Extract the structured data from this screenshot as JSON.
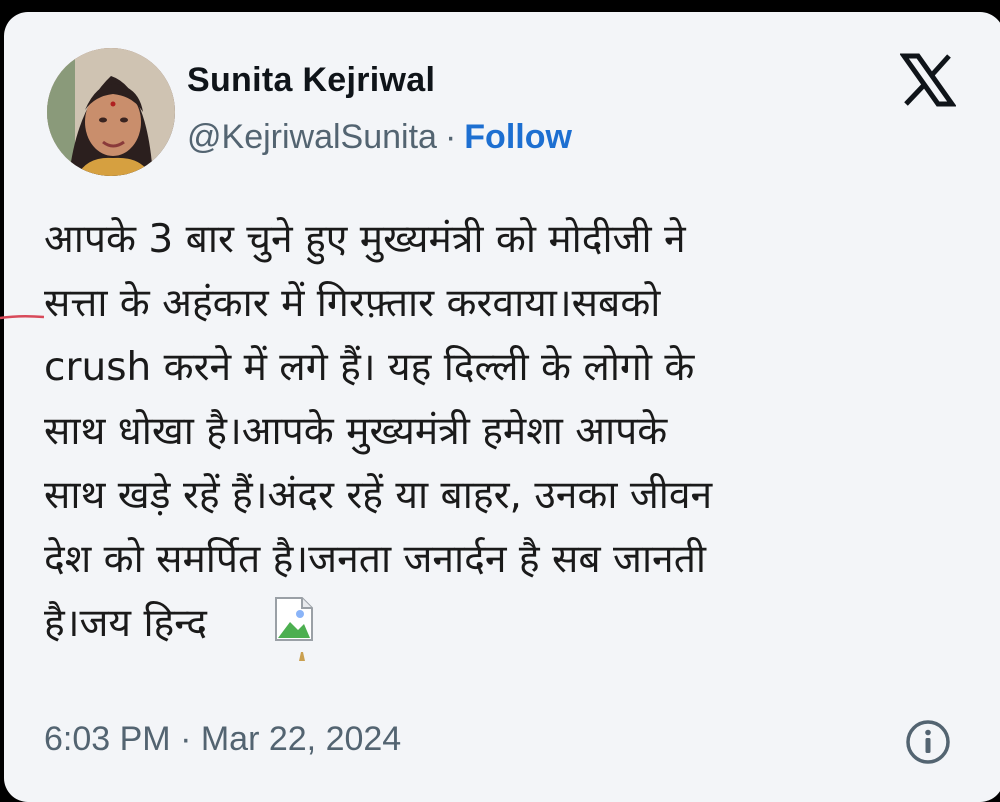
{
  "author": {
    "name": "Sunita Kejriwal",
    "handle": "@KejriwalSunita",
    "separator": "·",
    "follow_label": "Follow"
  },
  "tweet": {
    "text": "आपके 3 बार चुने हुए मुख्यमंत्री को मोदीजी ने\nसत्ता के अहंकार में गिरफ़्तार करवाया।सबको\ncrush करने में लगे हैं। यह दिल्ली के लोगो के\nसाथ धोखा है।आपके मुख्यमंत्री हमेशा आपके\nसाथ खड़े रहें हैं।अंदर रहें या बाहर, उनका जीवन\nदेश को समर्पित है।जनता जनार्दन है सब जानती\nहै।जय हिन्द",
    "time": "6:03 PM",
    "date_separator": "·",
    "date": "Mar 22, 2024"
  },
  "icons": {
    "avatar": "profile-photo",
    "platform_logo": "x-logo-icon",
    "embedded_image": "broken-image-icon",
    "info": "info-icon"
  },
  "colors": {
    "background": "#f3f5f8",
    "text": "#0f1419",
    "muted": "#536471",
    "follow": "#1d6fd1"
  }
}
